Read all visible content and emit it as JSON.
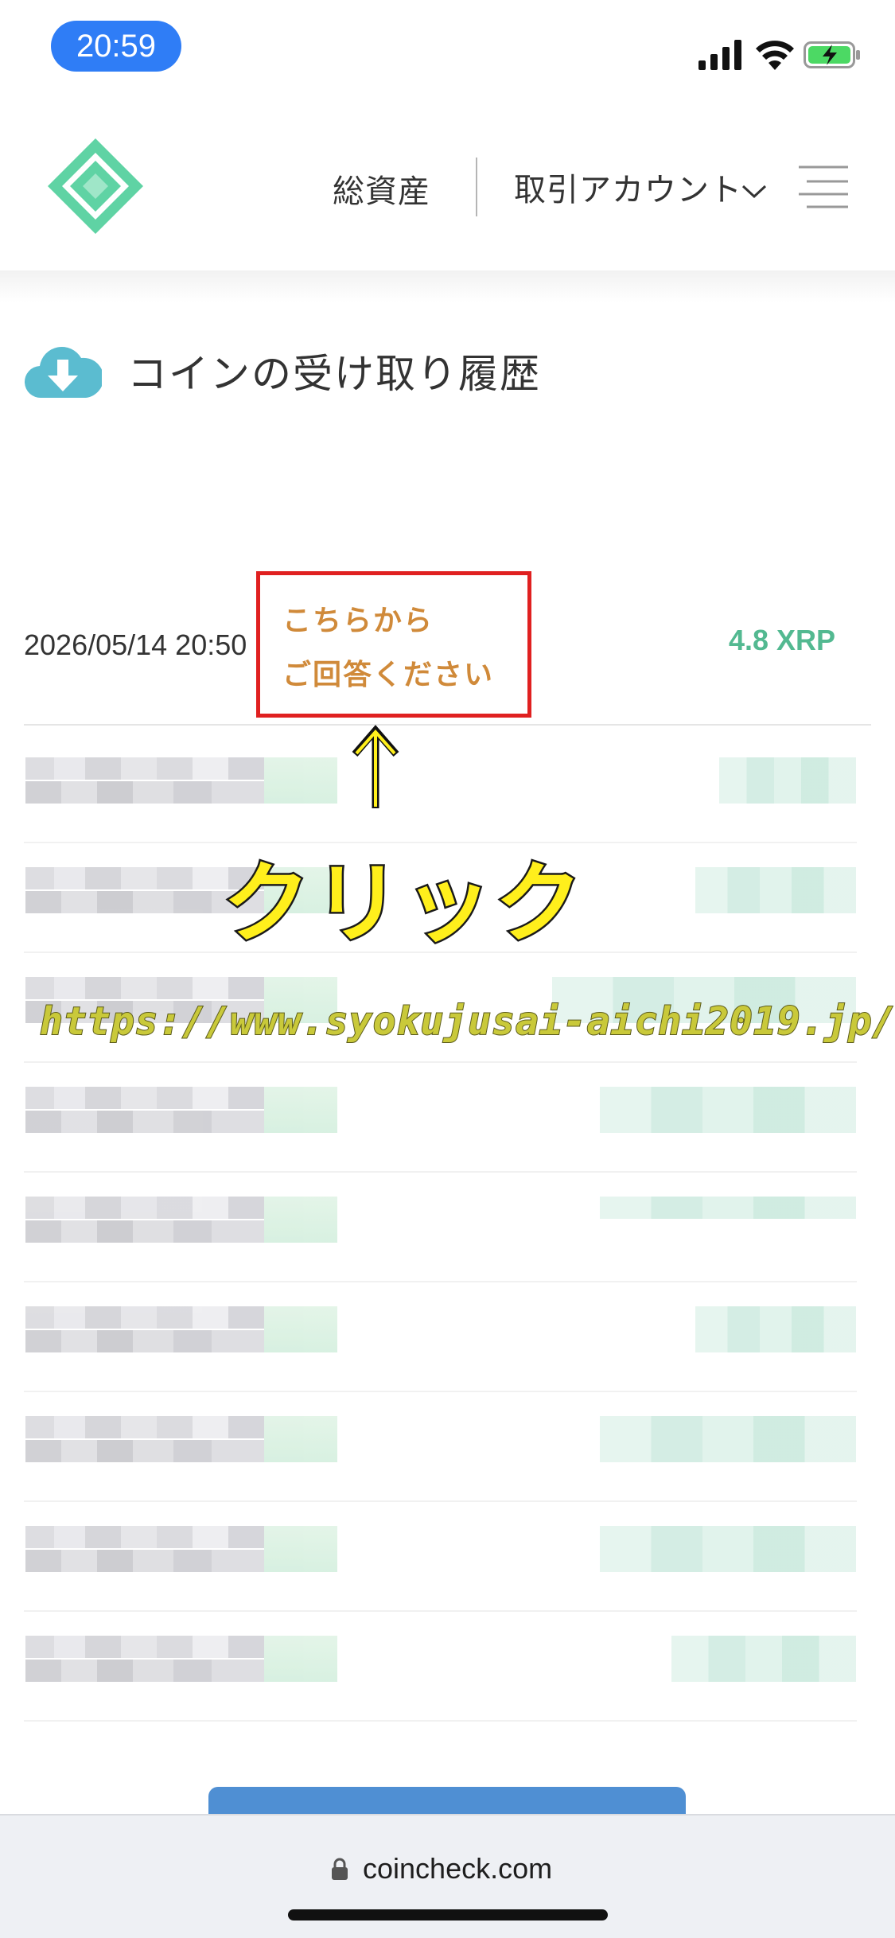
{
  "status_bar": {
    "time": "20:59"
  },
  "header": {
    "nav_assets": "総資産",
    "nav_account": "取引アカウント",
    "brand_color": "#5fd3a4"
  },
  "page": {
    "title": "コインの受け取り履歴"
  },
  "history": {
    "rows": [
      {
        "date": "2026/05/14 20:50",
        "amount": "4.8 XRP"
      }
    ],
    "amount_color": "#53b991"
  },
  "annotation": {
    "box_line1": "こちらから",
    "box_line2": "ご回答ください",
    "click_label": "クリック",
    "watermark_url": "https://www.syokujusai-aichi2019.jp/"
  },
  "browser": {
    "url": "coincheck.com"
  }
}
